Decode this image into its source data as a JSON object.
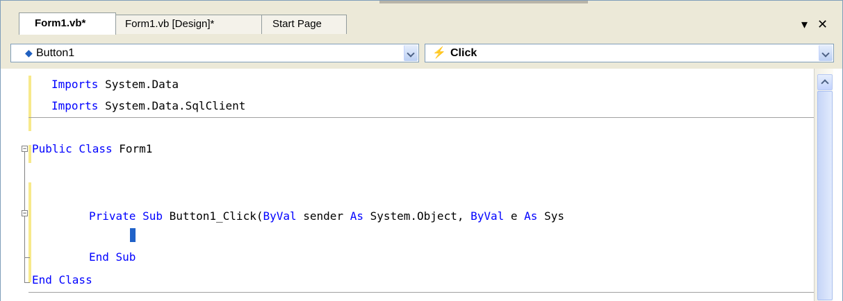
{
  "tabs": [
    {
      "label": "Form1.vb*",
      "active": true
    },
    {
      "label": "Form1.vb [Design]*",
      "active": false
    },
    {
      "label": "Start Page",
      "active": false
    }
  ],
  "tab_controls": {
    "dropdown_icon": "triangle-down-icon",
    "close_icon": "close-icon"
  },
  "nav": {
    "object_combo": {
      "value": "Button1",
      "icon": "control-icon"
    },
    "event_combo": {
      "value": "Click",
      "icon": "lightning-icon"
    }
  },
  "code_lines": [
    [
      "Imports",
      " System.Data"
    ],
    [
      "Imports",
      " System.Data.SqlClient"
    ],
    [
      "Public Class",
      " Form1"
    ],
    [
      "Private Sub",
      " Button1_Click(",
      "ByVal",
      " sender ",
      "As",
      " System.Object, ",
      "ByVal",
      " e ",
      "As",
      " Sys"
    ],
    [
      "End Sub",
      ""
    ],
    [
      "End Class",
      ""
    ]
  ],
  "colors": {
    "keyword": "#0000ff",
    "text": "#000000",
    "caret": "#2062c8",
    "change_marker": "#f7e98b"
  }
}
